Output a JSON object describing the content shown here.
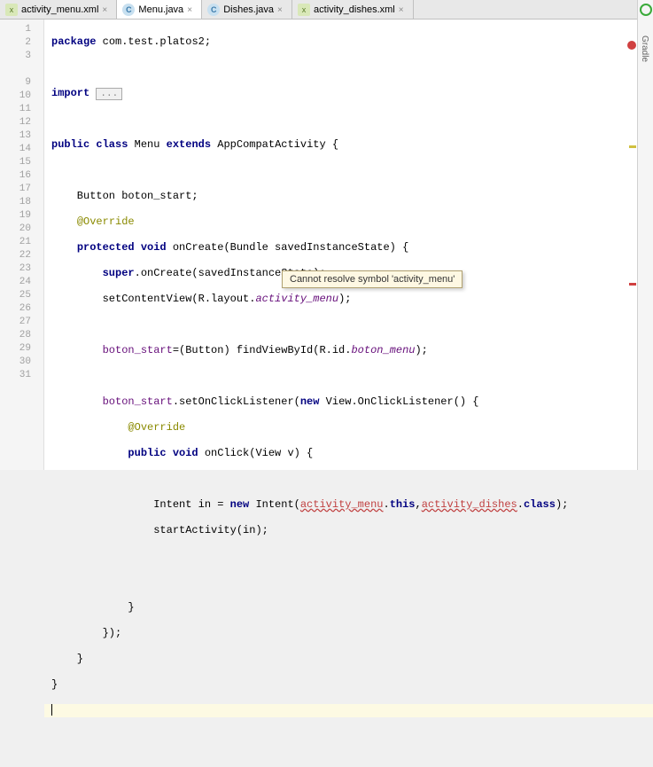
{
  "tabs": [
    {
      "label": "activity_menu.xml",
      "type": "xml",
      "active": false
    },
    {
      "label": "Menu.java",
      "type": "java",
      "active": true
    },
    {
      "label": "Dishes.java",
      "type": "java",
      "active": false
    },
    {
      "label": "activity_dishes.xml",
      "type": "xml",
      "active": false
    }
  ],
  "lines": [
    "1",
    "2",
    "3",
    "",
    "9",
    "10",
    "11",
    "12",
    "13",
    "14",
    "15",
    "16",
    "17",
    "18",
    "19",
    "20",
    "21",
    "22",
    "23",
    "24",
    "25",
    "26",
    "27",
    "28",
    "29",
    "30",
    "31"
  ],
  "tooltip": "Cannot resolve symbol 'activity_menu'",
  "right_panel": "Gradle",
  "code": {
    "l1_pkg": "package",
    "l1_rest": " com.test.platos2;",
    "l3_imp": "import",
    "l3_fold": "...",
    "l9_a": "public class",
    "l9_b": " Menu ",
    "l9_c": "extends",
    "l9_d": " AppCompatActivity {",
    "l11": "    Button boton_start;",
    "l12": "    ",
    "l12_ann": "@Override",
    "l13a": "    ",
    "l13b": "protected void",
    "l13c": " onCreate(Bundle savedInstanceState) {",
    "l14a": "        ",
    "l14b": "super",
    "l14c": ".onCreate(savedInstanceState);",
    "l15a": "        setContentView(R.layout.",
    "l15b": "activity_menu",
    "l15c": ");",
    "l17a": "        ",
    "l17b": "boton_start",
    "l17c": "=(Button) findViewById(R.id.",
    "l17d": "boton_menu",
    "l17e": ");",
    "l19a": "        ",
    "l19b": "boton_start",
    "l19c": ".setOnClickListener(",
    "l19d": "new",
    "l19e": " View.OnClickListener() {",
    "l20a": "            ",
    "l20b": "@Override",
    "l21a": "            ",
    "l21b": "public void",
    "l21c": " onClick(View v) {",
    "l23a": "                Intent in = ",
    "l23b": "new",
    "l23c": " Intent(",
    "l23d": "activity_menu",
    "l23e": ".",
    "l23f": "this",
    "l23g": ",",
    "l23h": "activity_dishes",
    "l23i": ".",
    "l23j": "class",
    "l23k": ");",
    "l24": "                startActivity(in);",
    "l27": "            }",
    "l28": "        });",
    "l29": "    }",
    "l30": "}"
  }
}
